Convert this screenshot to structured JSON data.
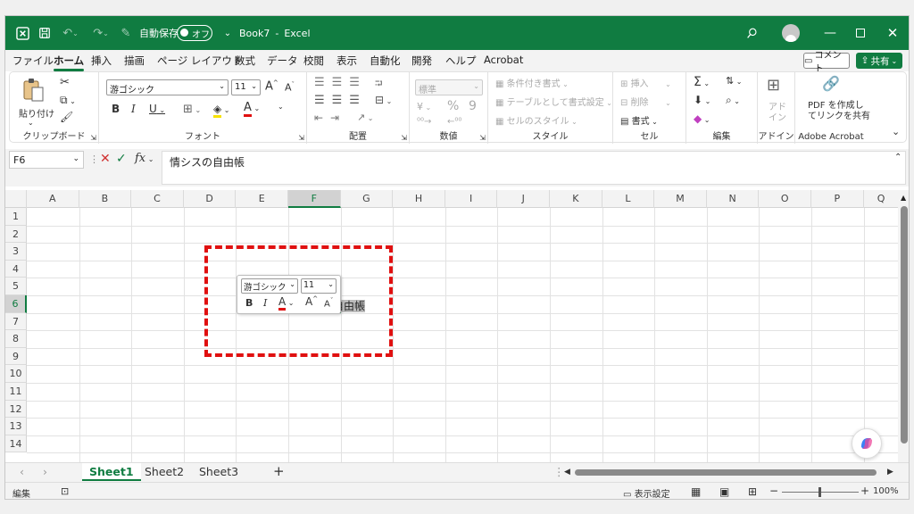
{
  "title": {
    "autosave_label": "自動保存",
    "autosave_state": "オフ",
    "doc_name": "Book7",
    "separator": "-",
    "app_name": "Excel"
  },
  "menu": {
    "tabs": [
      "ファイル",
      "ホーム",
      "挿入",
      "描画",
      "ページ レイアウト",
      "数式",
      "データ",
      "校閲",
      "表示",
      "自動化",
      "開発",
      "ヘルプ",
      "Acrobat"
    ],
    "active": "ホーム",
    "comment_label": "コメント",
    "share_label": "共有"
  },
  "ribbon": {
    "clipboard": {
      "paste": "貼り付け",
      "label": "クリップボード"
    },
    "font": {
      "name": "游ゴシック",
      "size": "11",
      "label": "フォント",
      "bold": "B",
      "italic": "I",
      "underline": "U",
      "font_color": "A",
      "grow": "A",
      "shrink": "A"
    },
    "alignment": {
      "label": "配置"
    },
    "number": {
      "format": "標準",
      "label": "数値",
      "percent": "%",
      "comma": "9"
    },
    "styles": {
      "conditional": "条件付き書式",
      "table": "テーブルとして書式設定",
      "cell_styles": "セルのスタイル",
      "label": "スタイル"
    },
    "cells": {
      "insert": "挿入",
      "delete": "削除",
      "format": "書式",
      "label": "セル"
    },
    "editing": {
      "label": "編集"
    },
    "addins": {
      "line1": "アド",
      "line2": "イン",
      "label": "アドイン"
    },
    "acrobat": {
      "line1": "PDF を作成し",
      "line2": "てリンクを共有",
      "label": "Adobe Acrobat"
    }
  },
  "formula_bar": {
    "name_box": "F6",
    "fx": "fx",
    "content": "情シスの自由帳"
  },
  "grid": {
    "columns": [
      "A",
      "B",
      "C",
      "D",
      "E",
      "F",
      "G",
      "H",
      "I",
      "J",
      "K",
      "L",
      "M",
      "N",
      "O",
      "P",
      "Q"
    ],
    "rows": [
      "1",
      "2",
      "3",
      "4",
      "5",
      "6",
      "7",
      "8",
      "9",
      "10",
      "11",
      "12",
      "13",
      "14"
    ],
    "selected_column": "F",
    "selected_row": "6",
    "cell_text": "情シスの自由帳"
  },
  "mini_toolbar": {
    "font": "游ゴシック",
    "size": "11",
    "bold": "B",
    "italic": "I",
    "color": "A",
    "grow": "A",
    "shrink": "A"
  },
  "sheets": [
    "Sheet1",
    "Sheet2",
    "Sheet3"
  ],
  "status": {
    "mode": "編集",
    "display_settings": "表示設定",
    "zoom": "100%"
  },
  "colors": {
    "accent": "#107c41",
    "highlight": "#e01010"
  }
}
